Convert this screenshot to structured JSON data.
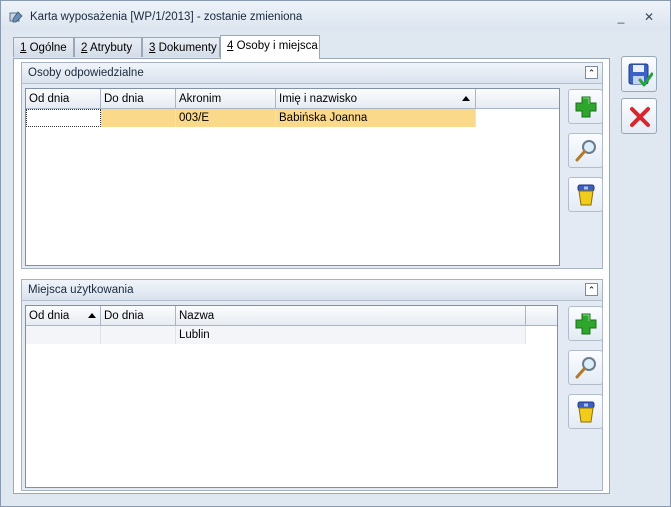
{
  "window": {
    "title": "Karta wyposażenia [WP/1/2013] - zostanie zmieniona",
    "minimize_glyph": "_",
    "close_glyph": "✕"
  },
  "tabs": [
    {
      "key": "1",
      "label": " Ogólne"
    },
    {
      "key": "2",
      "label": " Atrybuty"
    },
    {
      "key": "3",
      "label": " Dokumenty"
    },
    {
      "key": "4",
      "label": " Osoby i miejsca",
      "active": true
    }
  ],
  "persons": {
    "title": "Osoby odpowiedzialne",
    "collapse_glyph": "⌃",
    "columns": [
      "Od dnia",
      "Do dnia",
      "Akronim",
      "Imię i nazwisko"
    ],
    "sorted_column": "Imię i nazwisko",
    "rows": [
      {
        "from": "",
        "to": "",
        "acronym": "003/E",
        "name": "Babińska Joanna"
      }
    ]
  },
  "places": {
    "title": "Miejsca użytkowania",
    "collapse_glyph": "⌃",
    "columns": [
      "Od dnia",
      "Do dnia",
      "Nazwa"
    ],
    "sorted_column": "Od dnia",
    "rows": [
      {
        "from": "",
        "to": "",
        "name": "Lublin"
      }
    ]
  },
  "icons": {
    "add": "plus-icon",
    "edit": "magnifier-icon",
    "delete": "trash-icon",
    "save": "save-icon",
    "cancel": "cancel-icon"
  },
  "colors": {
    "selected_row": "#fbd98a",
    "add_green": "#2ea62e",
    "cancel_red": "#d8262e"
  }
}
